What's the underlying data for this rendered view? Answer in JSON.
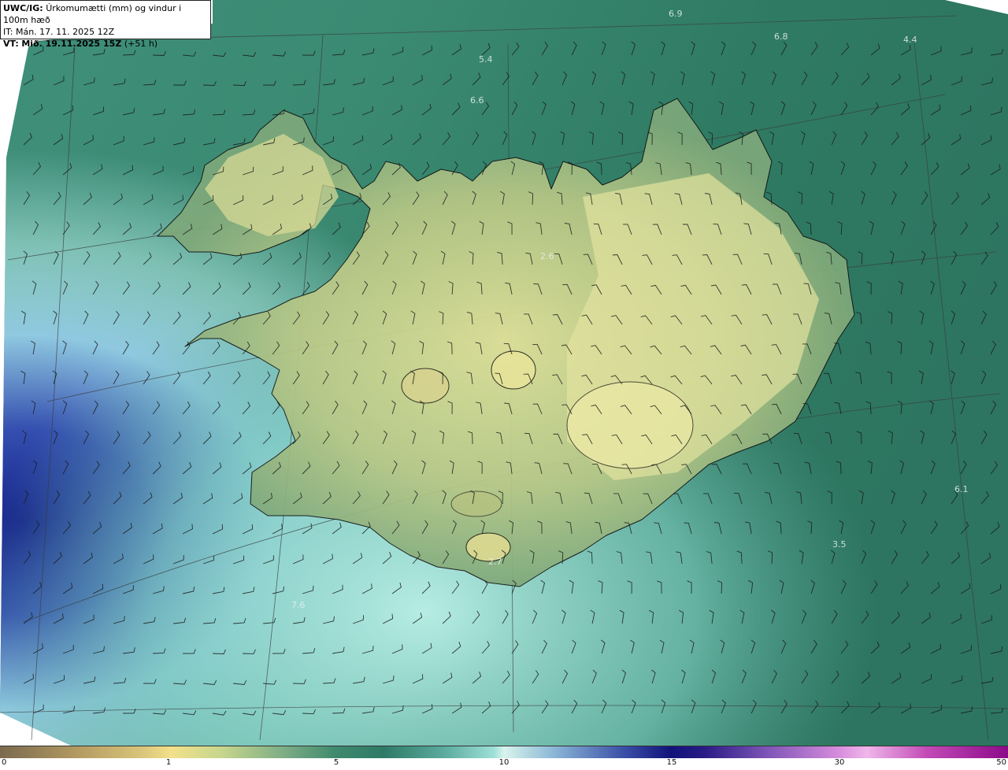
{
  "header": {
    "model": "UWC/IG:",
    "description": "Úrkomumætti (mm) og vindur i 100m hæð",
    "initial_time": "IT: Mán. 17. 11. 2025 12Z",
    "valid_label": "VT:",
    "valid_time": "Mið. 19.11.2025 15Z",
    "lead": "(+51 h)"
  },
  "map": {
    "field": "precipitable water (mm)",
    "point_values": [
      "6.9",
      "6.8",
      "4.4",
      "5.4",
      "6.6",
      "2.6",
      "6.1",
      "3.5",
      "2.7",
      "7.6"
    ]
  },
  "colorbar": {
    "ticks": [
      "0",
      "1",
      "5",
      "10",
      "15",
      "30",
      "50"
    ]
  }
}
